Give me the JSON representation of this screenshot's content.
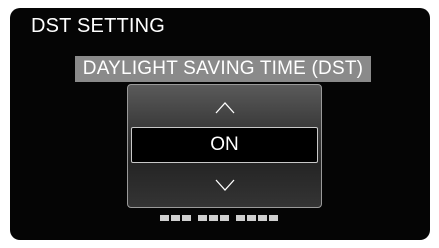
{
  "screen": {
    "title": "DST SETTING",
    "subtitle": "DAYLIGHT SAVING TIME (DST)"
  },
  "selector": {
    "up_icon": "chevron-up-icon",
    "down_icon": "chevron-down-icon",
    "current_value": "ON"
  },
  "colors": {
    "background": "#050505",
    "subtitle_bar": "#8a8a8a",
    "text": "#ffffff"
  }
}
